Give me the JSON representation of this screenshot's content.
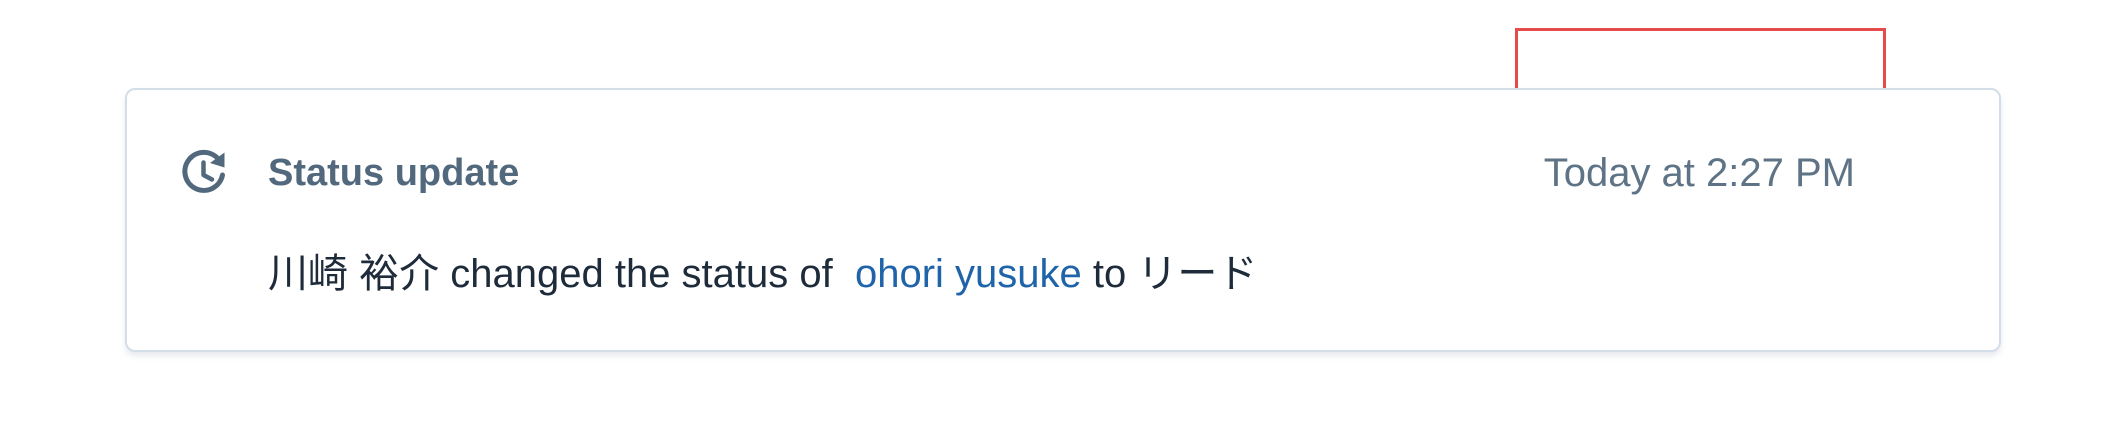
{
  "activity": {
    "icon": "history-clock-icon",
    "title": "Status update",
    "timestamp": "Today at 2:27 PM",
    "message": {
      "actor": "川崎 裕介",
      "verb_text": "changed the status of",
      "target": "ohori yusuke",
      "connector": "to",
      "new_status": "リード"
    }
  },
  "colors": {
    "title": "#51687d",
    "timestamp": "#5e7385",
    "text": "#1d2b3a",
    "link": "#1f63a8",
    "card_border": "#d3dee8",
    "highlight": "#e54b4b"
  }
}
